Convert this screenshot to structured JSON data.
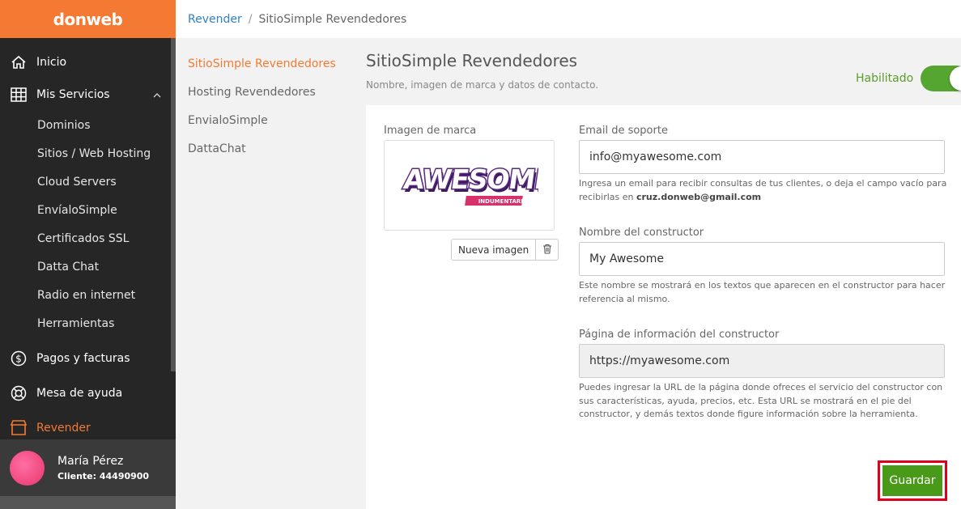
{
  "brand": {
    "name": "donweb"
  },
  "nav": {
    "inicio": "Inicio",
    "mis_servicios": "Mis Servicios",
    "servicios": [
      "Dominios",
      "Sitios / Web Hosting",
      "Cloud Servers",
      "EnvíaloSimple",
      "Certificados SSL",
      "Datta Chat",
      "Radio en internet",
      "Herramientas"
    ],
    "pagos": "Pagos y facturas",
    "mesa": "Mesa de ayuda",
    "revender": "Revender"
  },
  "user": {
    "name": "María Pérez",
    "client": "Cliente: 44490900"
  },
  "breadcrumb": {
    "parent": "Revender",
    "separator": "/",
    "current": "SitioSimple Revendedores"
  },
  "subnav": [
    "SitioSimple Revendedores",
    "Hosting Revendedores",
    "EnvialoSimple",
    "DattaChat"
  ],
  "page": {
    "title": "SitioSimple Revendedores",
    "subtitle": "Nombre, imagen de marca y datos de contacto.",
    "toggle_label": "Habilitado",
    "toggle_on": true
  },
  "form": {
    "brand_label": "Imagen de marca",
    "brand_logo": {
      "text": "AWESOME",
      "subtext": "INDUMENTARIA"
    },
    "new_image": "Nueva imagen",
    "email_label": "Email de soporte",
    "email_value": "info@myawesome.com",
    "email_help": "Ingresa un email para recibir consultas de tus clientes, o deja el campo vacío para recibirlas en",
    "email_help_bold": "cruz.donweb@gmail.com",
    "builder_label": "Nombre del constructor",
    "builder_value": "My Awesome",
    "builder_help": "Este nombre se mostrará en los textos que aparecen en el constructor para hacer referencia al mismo.",
    "url_label": "Página de información del constructor",
    "url_value": "https://myawesome.com",
    "url_help": "Puedes ingresar la URL de la página donde ofreces el servicio del constructor con sus características, ayuda, precios, etc. Esta URL se mostrará en el pie del constructor, y demás textos donde figure información sobre la herramienta.",
    "save": "Guardar"
  },
  "colors": {
    "accent": "#f47a33",
    "link": "#2f7fc1",
    "success": "#55a630",
    "sidebar": "#262626"
  }
}
